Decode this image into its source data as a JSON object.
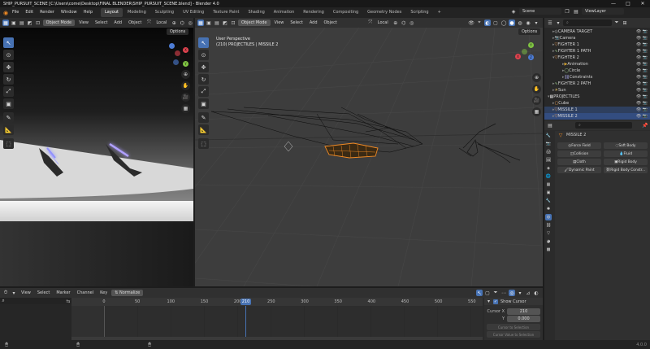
{
  "titlebar": {
    "title": "SHIP_PURSUIT_SCENE [C:\\Users\\come\\Desktop\\FINAL BLENDER\\SHIP_PURSUIT_SCENE.blend] - Blender 4.0",
    "minimize": "—",
    "maximize": "□",
    "close": "✕"
  },
  "menu": {
    "items": [
      "File",
      "Edit",
      "Render",
      "Window",
      "Help"
    ]
  },
  "workspaces": [
    "Layout",
    "Modeling",
    "Sculpting",
    "UV Editing",
    "Texture Paint",
    "Shading",
    "Animation",
    "Rendering",
    "Compositing",
    "Geometry Nodes",
    "Scripting"
  ],
  "scene_field": "Scene",
  "viewlayer_field": "ViewLayer",
  "left_view": {
    "mode": "Object Mode",
    "menus": [
      "View",
      "Select",
      "Add",
      "Object"
    ],
    "transform": "Local",
    "options": "Options"
  },
  "right_view": {
    "mode": "Object Mode",
    "menus": [
      "View",
      "Select",
      "Add",
      "Object"
    ],
    "transform": "Local",
    "options": "Options",
    "overlay_line1": "User Perspective",
    "overlay_line2": "(210) PROJECTILES | MISSILE 2"
  },
  "gizmo": {
    "x": "X",
    "y": "Y",
    "z": "Z"
  },
  "outliner": {
    "items": [
      {
        "label": "CAMERA TARGET",
        "indent": 1
      },
      {
        "label": "Camera",
        "indent": 1
      },
      {
        "label": "FIGHTER 1",
        "indent": 1
      },
      {
        "label": "FIGHTER 1 PATH",
        "indent": 1
      },
      {
        "label": "FIGHTER 2",
        "indent": 1
      },
      {
        "label": "Animation",
        "indent": 3
      },
      {
        "label": "Circle",
        "indent": 3
      },
      {
        "label": "Constraints",
        "indent": 3
      },
      {
        "label": "FIGHTER 2 PATH",
        "indent": 1
      },
      {
        "label": "Sun",
        "indent": 1
      },
      {
        "label": "PROJECTILES",
        "indent": 0
      },
      {
        "label": "Cube",
        "indent": 1
      },
      {
        "label": "MISSILE 1",
        "indent": 1
      },
      {
        "label": "MISSILE 2",
        "indent": 1
      }
    ]
  },
  "properties": {
    "object_name": "MISSILE 2",
    "physics": [
      "Force Field",
      "Soft Body",
      "Collision",
      "Fluid",
      "Cloth",
      "Rigid Body",
      "Dynamic Paint",
      "Rigid Body Constr..."
    ]
  },
  "timeline": {
    "menus": [
      "View",
      "Select",
      "Marker",
      "Channel",
      "Key"
    ],
    "normalize": "Normalize",
    "current_frame": "210",
    "ticks": [
      "0",
      "50",
      "100",
      "150",
      "200",
      "250",
      "300",
      "350",
      "400",
      "450",
      "500",
      "550"
    ],
    "channel_value": "200",
    "show_cursor": "Show Cursor",
    "cursor_x_label": "Cursor X",
    "cursor_x": "210",
    "cursor_y_label": "Y",
    "cursor_y": "0.000",
    "btn1": "Cursor to Selection",
    "btn2": "Cursor Value to Selection"
  },
  "statusbar": {
    "version": "4.0.0"
  },
  "colors": {
    "accent": "#4772b3",
    "selection_orange": "#f08a24",
    "bg": "#1d1d1d",
    "header": "#303030",
    "viewport_grid": "#3a3a3a"
  }
}
